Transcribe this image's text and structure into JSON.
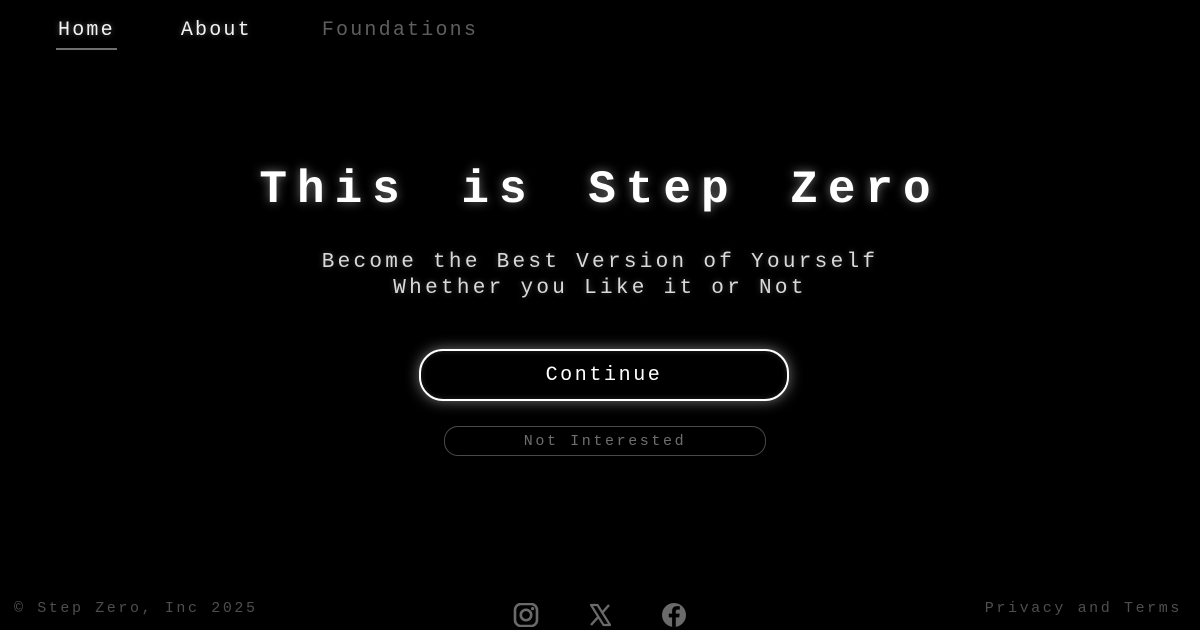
{
  "nav": {
    "items": [
      {
        "label": "Home",
        "active": true
      },
      {
        "label": "About",
        "active": false
      },
      {
        "label": "Foundations",
        "active": false
      }
    ]
  },
  "hero": {
    "title": "This is Step Zero",
    "subtitle_line1": "Become the Best Version of Yourself",
    "subtitle_line2": "Whether you Like it or Not"
  },
  "actions": {
    "continue_label": "Continue",
    "not_interested_label": "Not Interested"
  },
  "footer": {
    "copyright": "© Step Zero, Inc 2025",
    "legal_link": "Privacy and Terms",
    "social_icons": [
      "instagram-icon",
      "x-icon",
      "facebook-icon"
    ]
  },
  "colors": {
    "background": "#000000",
    "text": "#ffffff",
    "muted": "#4e4e4e",
    "inactive_nav": "#5e5e5e"
  }
}
